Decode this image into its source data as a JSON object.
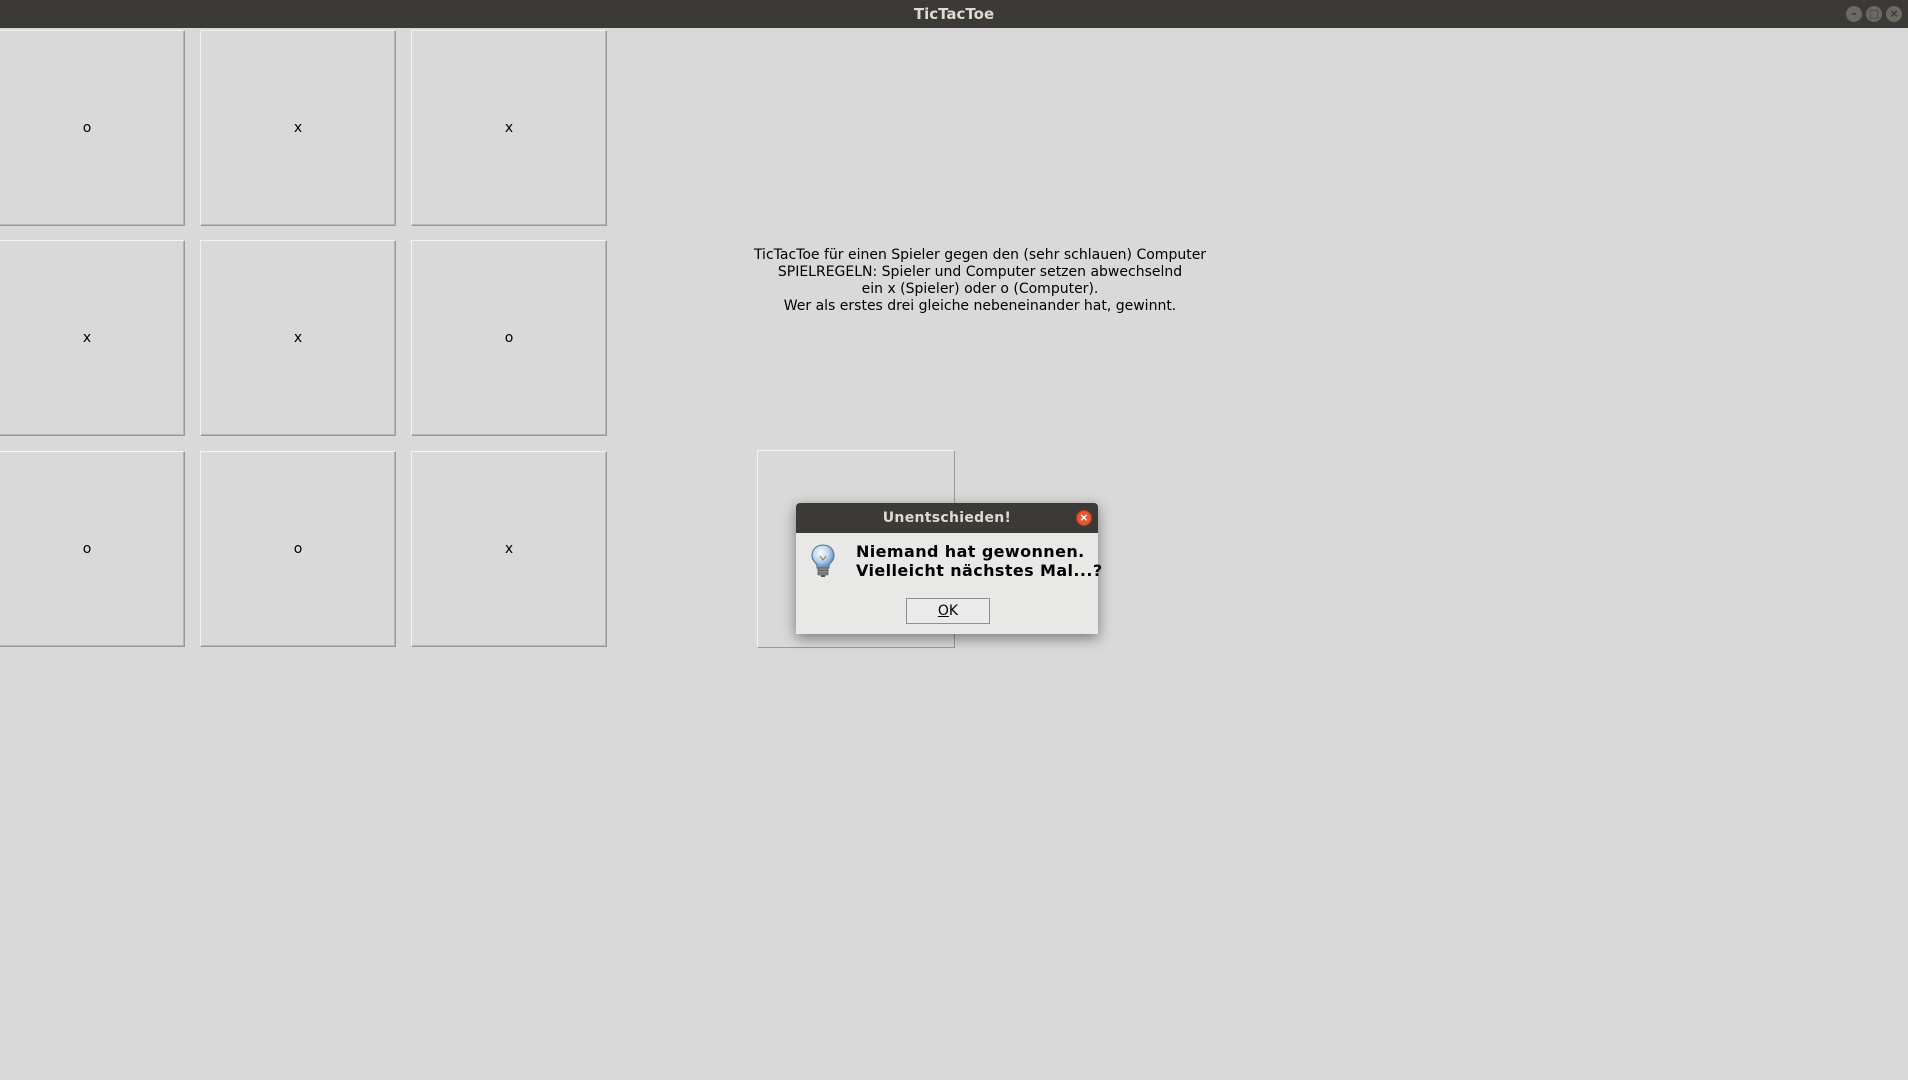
{
  "window": {
    "title": "TicTacToe"
  },
  "board": {
    "cells": [
      [
        "o",
        "x",
        "x"
      ],
      [
        "x",
        "x",
        "o"
      ],
      [
        "o",
        "o",
        "x"
      ]
    ]
  },
  "info": {
    "lines": [
      "TicTacToe für einen Spieler gegen den (sehr schlauen) Computer",
      "SPIELREGELN: Spieler und Computer setzen abwechselnd",
      "ein x (Spieler) oder o (Computer).",
      "Wer als erstes drei gleiche nebeneinander hat, gewinnt."
    ]
  },
  "dialog": {
    "title": "Unentschieden!",
    "message_lines": [
      "Niemand hat gewonnen.",
      "Vielleicht nächstes Mal...?"
    ],
    "ok_mnemonic": "O",
    "ok_rest": "K",
    "icon": "lightbulb-icon"
  },
  "colors": {
    "titlebar": "#3b3a36",
    "background": "#d9d9d9",
    "close_button": "#e05a34"
  }
}
